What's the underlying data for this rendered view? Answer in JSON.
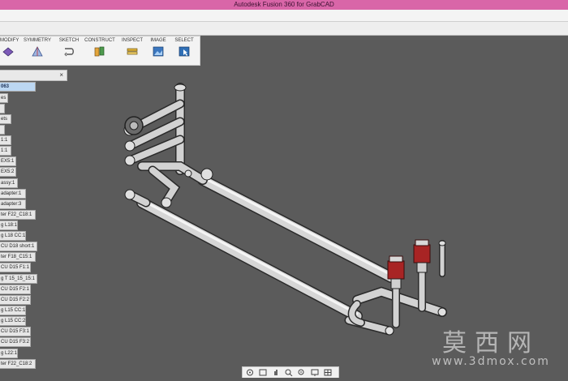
{
  "window": {
    "title": "Autodesk Fusion 360 for GrabCAD"
  },
  "toolbar": {
    "groups": [
      {
        "label": "MODIFY",
        "icon": "modify-icon"
      },
      {
        "label": "SYMMETRY",
        "icon": "symmetry-icon"
      },
      {
        "label": "SKETCH",
        "icon": "sketch-icon"
      },
      {
        "label": "CONSTRUCT",
        "icon": "construct-icon"
      },
      {
        "label": "INSPECT",
        "icon": "inspect-icon"
      },
      {
        "label": "IMAGE",
        "icon": "image-icon"
      },
      {
        "label": "SELECT",
        "icon": "select-icon"
      }
    ]
  },
  "browser": {
    "close_label": "×",
    "items": [
      "063",
      "es",
      "",
      "ets",
      "",
      "1:1",
      "1:1",
      "EX5:1",
      "EX5:2",
      "assy:1",
      "adapter:1",
      "adapter:3",
      "ter F22_C18:1",
      "g L18:1",
      "g L18 CC:1",
      "CU D18 short:1",
      "ter F18_C15:1",
      "CU D15 F1:1",
      "g T 15_15_15:1",
      "CU D15 F2:1",
      "CU D15 F2:2",
      "g L15 CC:1",
      "g L15 CC:2",
      "CU D15 F3:1",
      "CU D15 F3:2",
      "g L22:1",
      "ter F22_C18:2"
    ]
  },
  "watermark": {
    "cn": "莫西网",
    "url": "www.3dmox.com"
  },
  "colors": {
    "titlebar": "#d966a8",
    "viewport": "#5b5b5b",
    "selection": "#bcd7f2",
    "valve_red": "#a82424"
  }
}
